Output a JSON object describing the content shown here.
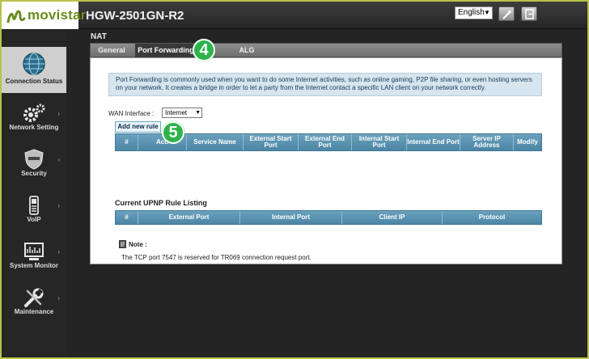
{
  "header": {
    "brand": "movistar",
    "model": "HGW-2501GN-R2",
    "language": "English"
  },
  "sidebar": {
    "items": [
      {
        "label": "Connection Status",
        "icon": "globe-icon",
        "active": true
      },
      {
        "label": "Network Setting",
        "icon": "gears-icon"
      },
      {
        "label": "Security",
        "icon": "shield-icon"
      },
      {
        "label": "VoIP",
        "icon": "phone-icon"
      },
      {
        "label": "System Monitor",
        "icon": "monitor-icon"
      },
      {
        "label": "Maintenance",
        "icon": "tools-icon"
      }
    ]
  },
  "main": {
    "section": "NAT",
    "tabs": [
      {
        "label": "General"
      },
      {
        "label": "Port Forwarding",
        "active": true
      },
      {
        "label": "ALG"
      }
    ],
    "info": "Port Forwarding is commonly used when you want to do some Internet activities, such as online gaming, P2P file sharing, or even hosting servers on your network.  It creates a bridge in order to let a party from the Internet contact a specific LAN client on your network correctly.",
    "wan_label": "WAN Interface :",
    "wan_value": "Internet",
    "add_button": "Add new rule",
    "pf_columns": [
      "#",
      "Acti",
      "Service Name",
      "External Start Port",
      "External End Port",
      "Internal Start Port",
      "Internal End Port",
      "Server IP Address",
      "Modify"
    ],
    "upnp_title": "Current UPNP Rule Listing",
    "upnp_columns": [
      "#",
      "External Port",
      "Internal Port",
      "Client IP",
      "Protocol"
    ],
    "note_title": "Note :",
    "note_text": "The TCP port  7547 is reserved for TR069 connection request port."
  },
  "callouts": [
    "4",
    "5"
  ],
  "colors": {
    "accent": "#4c86a4",
    "callout": "#2db34a",
    "brand": "#6c8b1e"
  }
}
